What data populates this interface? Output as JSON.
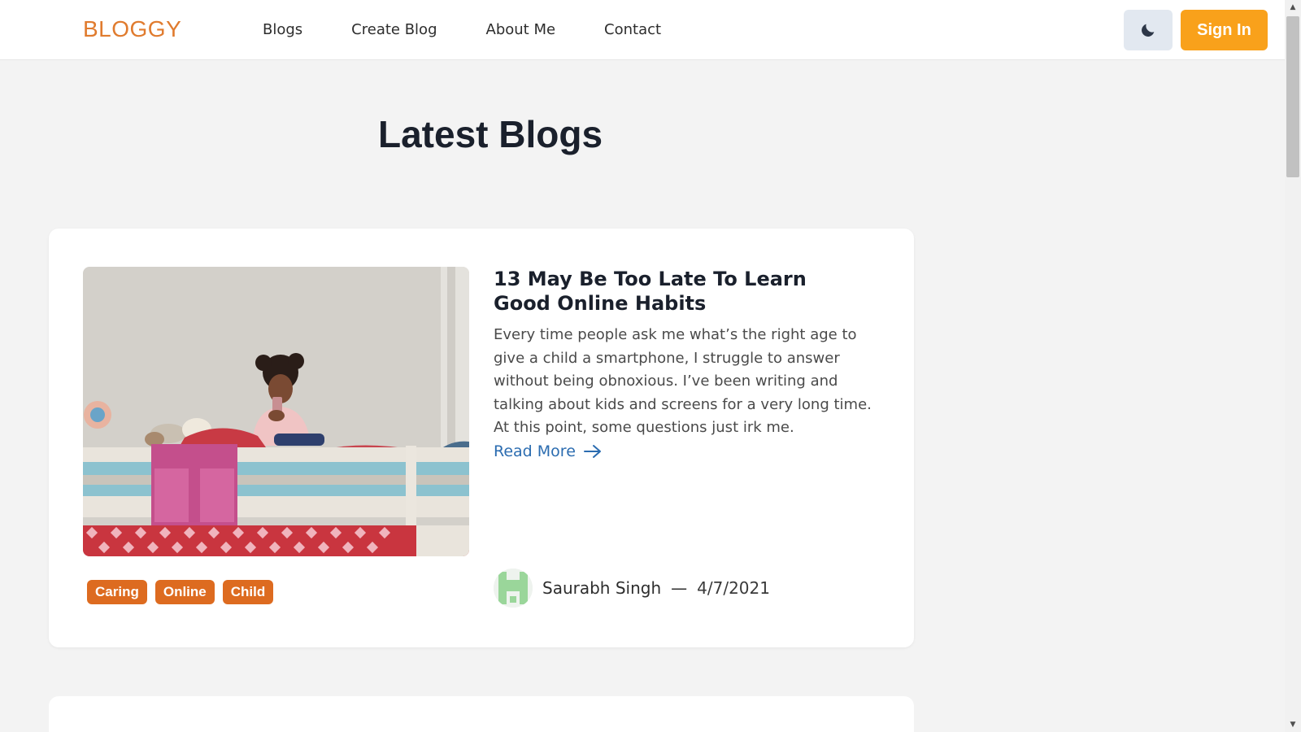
{
  "brand": {
    "logo": "BLOGGY",
    "color": "#e07b2e"
  },
  "nav": {
    "links": [
      "Blogs",
      "Create Blog",
      "About Me",
      "Contact"
    ],
    "theme_icon": "moon-icon",
    "signin_label": "Sign In",
    "signin_color": "#f9a11b"
  },
  "main": {
    "title": "Latest Blogs",
    "posts": [
      {
        "title": "13 May Be Too Late To Learn Good Online Habits",
        "excerpt": "Every time people ask me what’s the right age to give a child a smartphone, I struggle to answer without being obnoxious. I’ve been writing and talking about kids and screens for a very long time. At this point, some questions just irk me.",
        "read_more": "Read More",
        "tags": [
          "Caring",
          "Online",
          "Child"
        ],
        "author": "Saurabh Singh",
        "separator": "—",
        "date": "4/7/2021",
        "image": "photo of a girl sitting on a bunk bed holding a smartphone"
      }
    ]
  },
  "colors": {
    "tag": "#dd6b20",
    "link": "#2b6cb0",
    "background": "#f3f3f3"
  }
}
